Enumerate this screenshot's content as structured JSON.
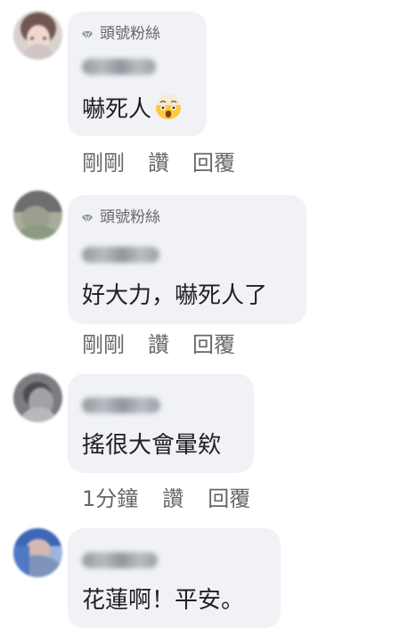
{
  "comments": [
    {
      "badge": "頭號粉絲",
      "text": "嚇死人",
      "emoji": "exploding-head-emoji",
      "time": "剛剛",
      "like": "讚",
      "reply": "回覆"
    },
    {
      "badge": "頭號粉絲",
      "text": "好大力，嚇死人了",
      "time": "剛剛",
      "like": "讚",
      "reply": "回覆"
    },
    {
      "text": "搖很大會暈欸",
      "time": "1分鐘",
      "like": "讚",
      "reply": "回覆"
    },
    {
      "text": "花蓮啊！平安。"
    }
  ],
  "colors": {
    "bubble": "#f0f2f5",
    "secondary_text": "#65676b",
    "main_text": "#1f2022"
  }
}
